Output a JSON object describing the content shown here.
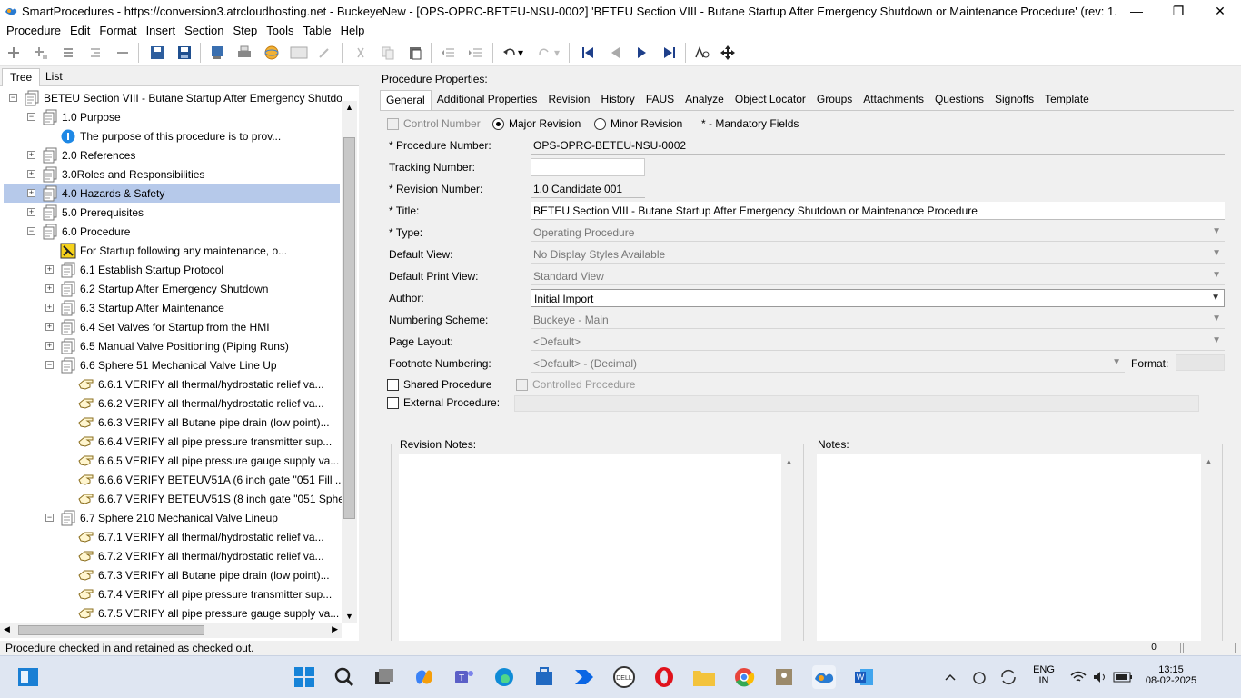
{
  "window": {
    "title": "SmartProcedures - https://conversion3.atrcloudhosting.net - BuckeyeNew - [OPS-OPRC-BETEU-NSU-0002] 'BETEU Section VIII - Butane Startup After Emergency Shutdown or Maintenance Procedure' (rev: 1.0 Candidate 001)",
    "minimize": "—",
    "restore": "❐",
    "close": "✕"
  },
  "menu": [
    "Procedure",
    "Edit",
    "Format",
    "Insert",
    "Section",
    "Step",
    "Tools",
    "Table",
    "Help"
  ],
  "left_tabs": [
    "Tree",
    "List"
  ],
  "tree": [
    {
      "label": "BETEU Section VIII - Butane Startup After Emergency Shutdo...",
      "icon": "document-icon",
      "expander": "−"
    },
    {
      "label": "1.0 Purpose",
      "icon": "document-icon",
      "expander": "−"
    },
    {
      "label": "The purpose of this procedure is to prov...",
      "icon": "info-icon",
      "expander": ""
    },
    {
      "label": "2.0 References",
      "icon": "document-icon",
      "expander": "+"
    },
    {
      "label": "3.0Roles and Responsibilities",
      "icon": "document-icon",
      "expander": "+"
    },
    {
      "label": "4.0 Hazards & Safety",
      "icon": "document-icon",
      "expander": "+"
    },
    {
      "label": "5.0 Prerequisites",
      "icon": "document-icon",
      "expander": "+"
    },
    {
      "label": "6.0 Procedure",
      "icon": "document-icon",
      "expander": "−"
    },
    {
      "label": "For Startup following any maintenance, o...",
      "icon": "warning-icon",
      "expander": ""
    },
    {
      "label": "6.1 Establish Startup Protocol",
      "icon": "document-icon",
      "expander": "+"
    },
    {
      "label": "6.2 Startup After Emergency Shutdown",
      "icon": "document-icon",
      "expander": "+"
    },
    {
      "label": "6.3 Startup After Maintenance",
      "icon": "document-icon",
      "expander": "+"
    },
    {
      "label": "6.4 Set Valves for Startup from the HMI",
      "icon": "document-icon",
      "expander": "+"
    },
    {
      "label": "6.5 Manual Valve Positioning (Piping Runs)",
      "icon": "document-icon",
      "expander": "+"
    },
    {
      "label": "6.6 Sphere 51 Mechanical Valve Line Up",
      "icon": "document-icon",
      "expander": "−"
    },
    {
      "label": "6.6.1 VERIFY all thermal/hydrostatic relief va...",
      "icon": "hand-icon",
      "expander": ""
    },
    {
      "label": "6.6.2 VERIFY all thermal/hydrostatic relief va...",
      "icon": "hand-icon",
      "expander": ""
    },
    {
      "label": "6.6.3 VERIFY all Butane pipe drain (low point)...",
      "icon": "hand-icon",
      "expander": ""
    },
    {
      "label": "6.6.4 VERIFY all pipe pressure transmitter sup...",
      "icon": "hand-icon",
      "expander": ""
    },
    {
      "label": "6.6.5 VERIFY all pipe pressure gauge supply va...",
      "icon": "hand-icon",
      "expander": ""
    },
    {
      "label": "6.6.6 VERIFY BETEUV51A (6 inch gate \"051 Fill ...",
      "icon": "hand-icon",
      "expander": ""
    },
    {
      "label": "6.6.7 VERIFY BETEUV51S (8 inch gate \"051 Spher...",
      "icon": "hand-icon",
      "expander": ""
    },
    {
      "label": "6.7 Sphere 210 Mechanical Valve Lineup",
      "icon": "document-icon",
      "expander": "−"
    },
    {
      "label": "6.7.1 VERIFY all thermal/hydrostatic relief va...",
      "icon": "hand-icon",
      "expander": ""
    },
    {
      "label": "6.7.2 VERIFY all thermal/hydrostatic relief va...",
      "icon": "hand-icon",
      "expander": ""
    },
    {
      "label": "6.7.3 VERIFY all Butane pipe drain (low point)...",
      "icon": "hand-icon",
      "expander": ""
    },
    {
      "label": "6.7.4 VERIFY all pipe pressure transmitter sup...",
      "icon": "hand-icon",
      "expander": ""
    },
    {
      "label": "6.7.5 VERIFY all pipe pressure gauge supply va...",
      "icon": "hand-icon",
      "expander": ""
    }
  ],
  "selected_tree_item": "4.0 Hazards & Safety",
  "properties": {
    "title": "Procedure Properties:",
    "tabs": [
      "General",
      "Additional Properties",
      "Revision",
      "History",
      "FAUS",
      "Analyze",
      "Object Locator",
      "Groups",
      "Attachments",
      "Questions",
      "Signoffs",
      "Template"
    ],
    "control_number_label": "Control Number",
    "major_revision_label": "Major Revision",
    "minor_revision_label": "Minor Revision",
    "mandatory_note": "* - Mandatory Fields",
    "fields": {
      "procedure_number": {
        "label": "* Procedure Number:",
        "value": "OPS-OPRC-BETEU-NSU-0002"
      },
      "tracking_number": {
        "label": "Tracking Number:",
        "value": ""
      },
      "revision_number": {
        "label": "* Revision Number:",
        "value": "1.0 Candidate 001"
      },
      "title": {
        "label": "* Title:",
        "value": "BETEU Section VIII - Butane Startup After Emergency Shutdown or Maintenance Procedure"
      },
      "type": {
        "label": "* Type:",
        "value": "Operating Procedure"
      },
      "default_view": {
        "label": "Default View:",
        "value": "No Display Styles Available"
      },
      "default_print_view": {
        "label": "Default Print View:",
        "value": "Standard View"
      },
      "author": {
        "label": "Author:",
        "value": "Initial Import"
      },
      "numbering_scheme": {
        "label": "Numbering Scheme:",
        "value": "Buckeye - Main"
      },
      "page_layout": {
        "label": "Page Layout:",
        "value": "<Default>"
      },
      "footnote_numbering": {
        "label": "Footnote Numbering:",
        "value": "<Default> - (Decimal)"
      },
      "format": {
        "label": "Format:",
        "value": ""
      }
    },
    "shared_procedure_label": "Shared Procedure",
    "controlled_procedure_label": "Controlled Procedure",
    "external_procedure_label": "External Procedure:",
    "revision_notes_label": "Revision Notes:",
    "notes_label": "Notes:"
  },
  "status": {
    "text": "Procedure checked in and retained as checked out.",
    "counter": "0"
  },
  "taskbar": {
    "tray_lang": "ENG",
    "tray_region": "IN",
    "time": "13:15",
    "date": "08-02-2025"
  }
}
